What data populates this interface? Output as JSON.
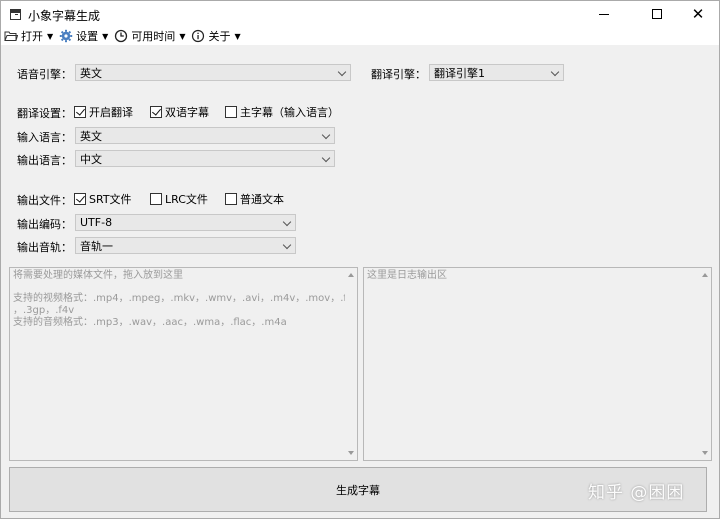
{
  "window": {
    "title": "小象字幕生成"
  },
  "menu": [
    {
      "label": "打开",
      "icon": "folder-icon"
    },
    {
      "label": "设置",
      "icon": "gear-icon"
    },
    {
      "label": "可用时间",
      "icon": "clock-icon"
    },
    {
      "label": "关于",
      "icon": "info-icon"
    }
  ],
  "form": {
    "speech_engine_label": "语音引擎：",
    "speech_engine_value": "英文",
    "translate_engine_label": "翻译引擎：",
    "translate_engine_value": "翻译引擎1",
    "translate_settings_label": "翻译设置：",
    "enable_translate": {
      "label": "开启翻译",
      "checked": true
    },
    "bilingual": {
      "label": "双语字幕",
      "checked": true
    },
    "main_subtitle": {
      "label": "主字幕（输入语言）",
      "checked": false
    },
    "input_lang_label": "输入语言：",
    "input_lang_value": "英文",
    "output_lang_label": "输出语言：",
    "output_lang_value": "中文",
    "output_file_label": "输出文件：",
    "srt": {
      "label": "SRT文件",
      "checked": true
    },
    "lrc": {
      "label": "LRC文件",
      "checked": false
    },
    "txt": {
      "label": "普通文本",
      "checked": false
    },
    "encoding_label": "输出编码：",
    "encoding_value": "UTF-8",
    "audio_track_label": "输出音轨：",
    "audio_track_value": "音轨一"
  },
  "input_pane": {
    "line1": "将需要处理的媒体文件，拖入放到这里",
    "line2": "支持的视频格式：.mp4，.mpeg，.mkv，.wmv，.avi，.m4v，.mov，.flv，.rmvb",
    "line3": "，.3gp，.f4v",
    "line4": "支持的音频格式：.mp3，.wav，.aac，.wma，.flac，.m4a"
  },
  "log_pane": {
    "placeholder": "这里是日志输出区"
  },
  "generate_button": {
    "label": "生成字幕"
  },
  "watermark": {
    "text": "知乎 @困困"
  }
}
